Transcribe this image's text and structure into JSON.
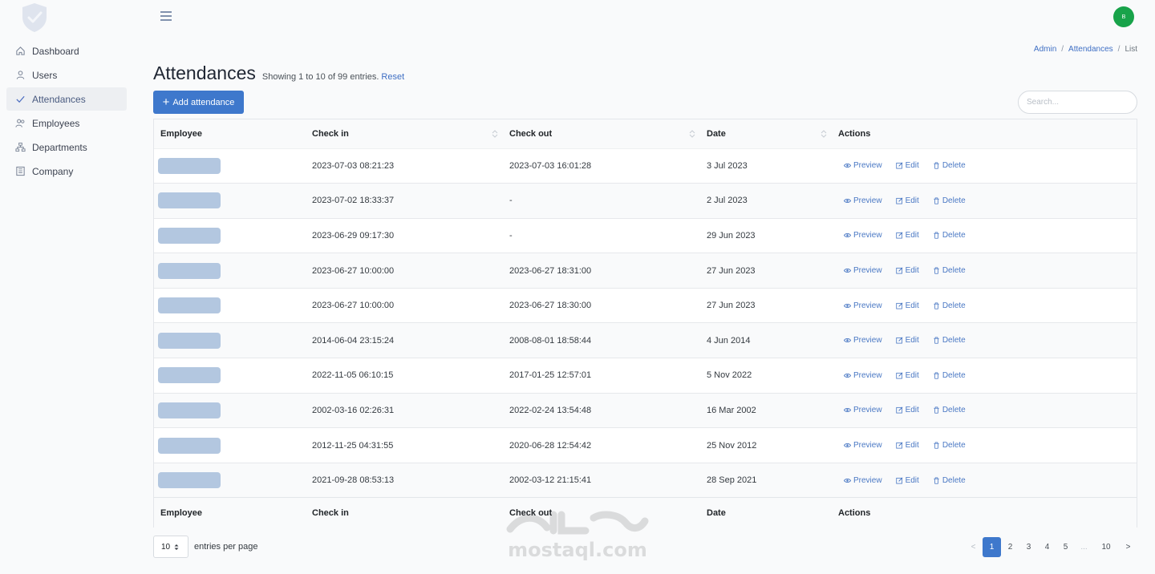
{
  "sidebar": {
    "items": [
      {
        "label": "Dashboard",
        "icon": "home-icon",
        "active": false
      },
      {
        "label": "Users",
        "icon": "user-icon",
        "active": false
      },
      {
        "label": "Attendances",
        "icon": "check-icon",
        "active": true
      },
      {
        "label": "Employees",
        "icon": "users-icon",
        "active": false
      },
      {
        "label": "Departments",
        "icon": "sitemap-icon",
        "active": false
      },
      {
        "label": "Company",
        "icon": "building-icon",
        "active": false
      }
    ]
  },
  "header": {
    "avatar_initial": "B"
  },
  "breadcrumb": [
    "Admin",
    "Attendances",
    "List"
  ],
  "page": {
    "title": "Attendances",
    "showing": "Showing 1 to 10 of 99 entries.",
    "reset": "Reset",
    "add_button": "Add attendance",
    "search_placeholder": "Search..."
  },
  "table": {
    "columns": [
      "Employee",
      "Check in",
      "Check out",
      "Date",
      "Actions"
    ],
    "actions": {
      "preview": "Preview",
      "edit": "Edit",
      "delete": "Delete"
    },
    "rows": [
      {
        "check_in": "2023-07-03 08:21:23",
        "check_out": "2023-07-03 16:01:28",
        "date": "3 Jul 2023"
      },
      {
        "check_in": "2023-07-02 18:33:37",
        "check_out": "-",
        "date": "2 Jul 2023"
      },
      {
        "check_in": "2023-06-29 09:17:30",
        "check_out": "-",
        "date": "29 Jun 2023"
      },
      {
        "check_in": "2023-06-27 10:00:00",
        "check_out": "2023-06-27 18:31:00",
        "date": "27 Jun 2023"
      },
      {
        "check_in": "2023-06-27 10:00:00",
        "check_out": "2023-06-27 18:30:00",
        "date": "27 Jun 2023"
      },
      {
        "check_in": "2014-06-04 23:15:24",
        "check_out": "2008-08-01 18:58:44",
        "date": "4 Jun 2014"
      },
      {
        "check_in": "2022-11-05 06:10:15",
        "check_out": "2017-01-25 12:57:01",
        "date": "5 Nov 2022"
      },
      {
        "check_in": "2002-03-16 02:26:31",
        "check_out": "2022-02-24 13:54:48",
        "date": "16 Mar 2002"
      },
      {
        "check_in": "2012-11-25 04:31:55",
        "check_out": "2020-06-28 12:54:42",
        "date": "25 Nov 2012"
      },
      {
        "check_in": "2021-09-28 08:53:13",
        "check_out": "2002-03-12 21:15:41",
        "date": "28 Sep 2021"
      }
    ]
  },
  "footer": {
    "per_page_value": "10",
    "per_page_label": "entries per page",
    "pages": [
      "<",
      "1",
      "2",
      "3",
      "4",
      "5",
      "...",
      "10",
      ">"
    ],
    "current_page": "1"
  },
  "watermark": {
    "text": "mostaql.com"
  },
  "colors": {
    "primary": "#3e78cc",
    "link": "#4a78c4",
    "avatar": "#18a34a",
    "employee_placeholder": "#b3c7e0"
  }
}
